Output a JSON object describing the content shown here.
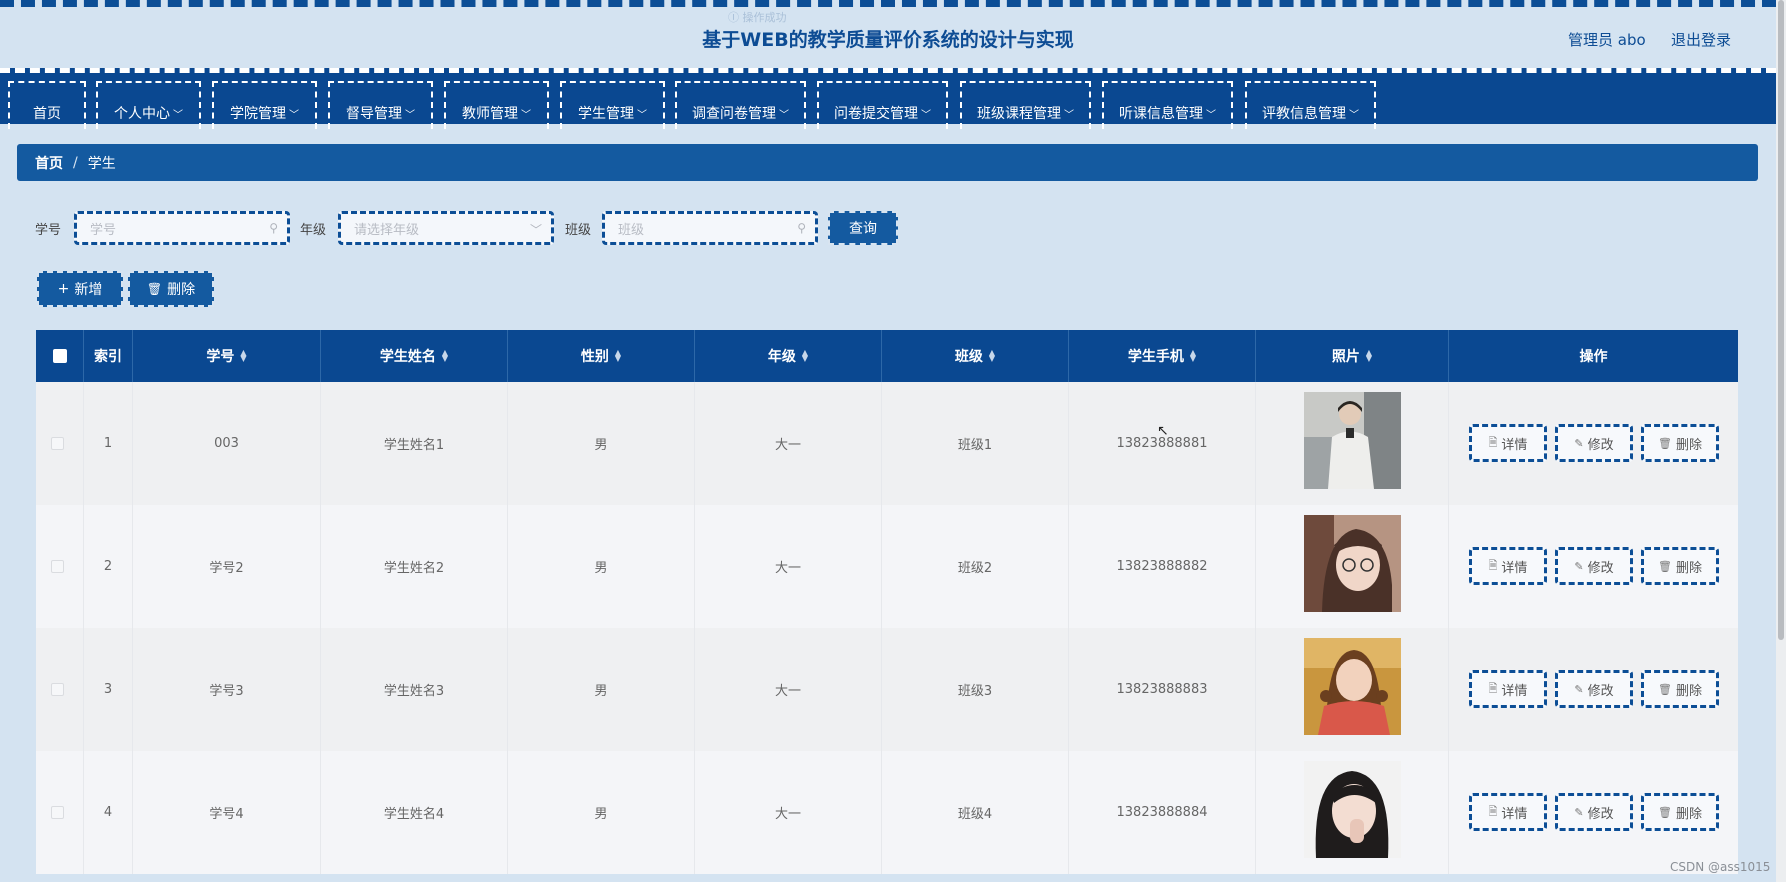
{
  "header": {
    "faint_text": "Ⓘ 操作成功",
    "title": "基于WEB的教学质量评价系统的设计与实现",
    "admin": "管理员 abo",
    "logout": "退出登录"
  },
  "nav": {
    "items": [
      {
        "label": "首页",
        "dropdown": false
      },
      {
        "label": "个人中心",
        "dropdown": true
      },
      {
        "label": "学院管理",
        "dropdown": true
      },
      {
        "label": "督导管理",
        "dropdown": true
      },
      {
        "label": "教师管理",
        "dropdown": true
      },
      {
        "label": "学生管理",
        "dropdown": true
      },
      {
        "label": "调查问卷管理",
        "dropdown": true
      },
      {
        "label": "问卷提交管理",
        "dropdown": true
      },
      {
        "label": "班级课程管理",
        "dropdown": true
      },
      {
        "label": "听课信息管理",
        "dropdown": true
      },
      {
        "label": "评教信息管理",
        "dropdown": true
      }
    ]
  },
  "breadcrumb": {
    "home": "首页",
    "separator": "/",
    "current": "学生"
  },
  "search": {
    "student_id_label": "学号",
    "student_id_placeholder": "学号",
    "grade_label": "年级",
    "grade_placeholder": "请选择年级",
    "class_label": "班级",
    "class_placeholder": "班级",
    "query_button": "查询"
  },
  "actions": {
    "add": "新增",
    "delete": "删除"
  },
  "table": {
    "columns": [
      "索引",
      "学号",
      "学生姓名",
      "性别",
      "年级",
      "班级",
      "学生手机",
      "照片",
      "操作"
    ],
    "rows": [
      {
        "index": "1",
        "student_id": "003",
        "name": "学生姓名1",
        "gender": "男",
        "grade": "大一",
        "class": "班级1",
        "phone": "13823888881"
      },
      {
        "index": "2",
        "student_id": "学号2",
        "name": "学生姓名2",
        "gender": "男",
        "grade": "大一",
        "class": "班级2",
        "phone": "13823888882"
      },
      {
        "index": "3",
        "student_id": "学号3",
        "name": "学生姓名3",
        "gender": "男",
        "grade": "大一",
        "class": "班级3",
        "phone": "13823888883"
      },
      {
        "index": "4",
        "student_id": "学号4",
        "name": "学生姓名4",
        "gender": "男",
        "grade": "大一",
        "class": "班级4",
        "phone": "13823888884"
      }
    ],
    "row_actions": {
      "detail": "详情",
      "edit": "修改",
      "delete": "删除"
    }
  },
  "watermark": "CSDN @ass1015",
  "colors": {
    "primary": "#0a4891",
    "accent": "#145aa0",
    "background": "#d4e3f1"
  }
}
